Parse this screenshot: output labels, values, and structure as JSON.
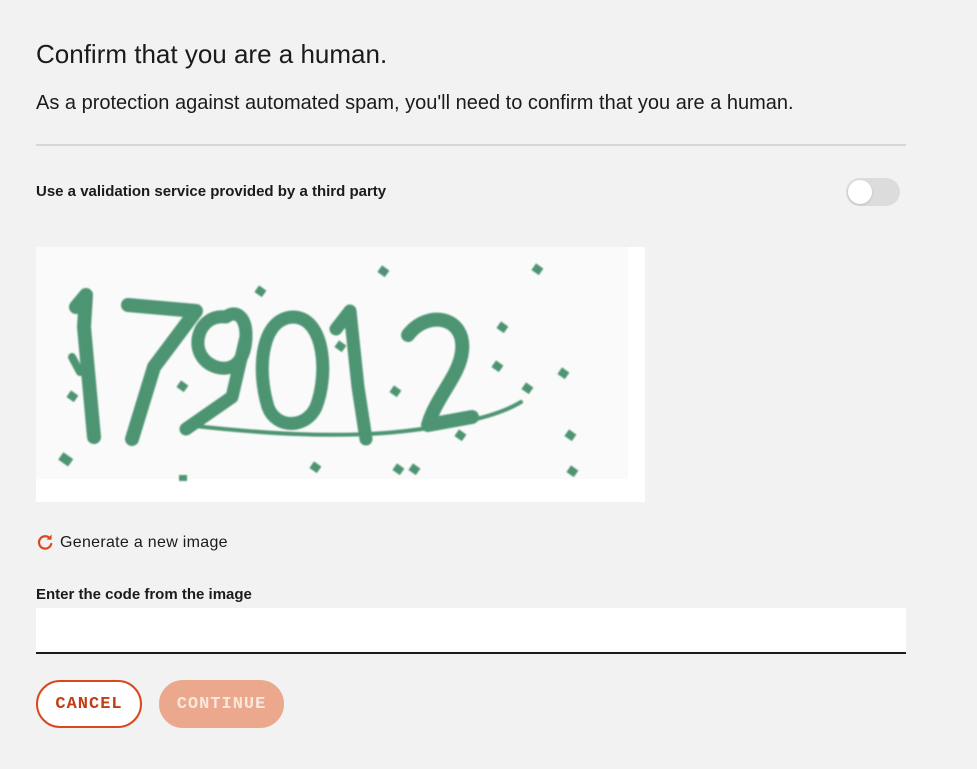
{
  "dialog": {
    "title": "Confirm that you are a human.",
    "subtitle": "As a protection against automated spam, you'll need to confirm that you are a human."
  },
  "validation_toggle": {
    "label": "Use a validation service provided by a third party",
    "state": "off"
  },
  "captcha": {
    "code": "179012",
    "refresh_label": "Generate a new image"
  },
  "code_field": {
    "label": "Enter the code from the image",
    "value": "",
    "placeholder": ""
  },
  "buttons": {
    "cancel_label": "CANCEL",
    "continue_label": "CONTINUE"
  },
  "colors": {
    "accent": "#d9481c",
    "accent_disabled": "#eba88d",
    "captcha_ink": "#4e9472",
    "background": "#f2f2f2"
  },
  "icons": {
    "refresh": "refresh-icon"
  }
}
